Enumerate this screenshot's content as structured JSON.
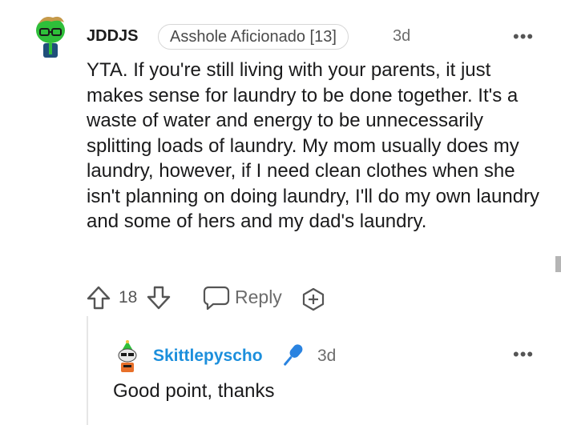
{
  "comment": {
    "username": "JDDJS",
    "flair": "Asshole Aficionado [13]",
    "time": "3d",
    "more": "•••",
    "body": "YTA. If you're still living with your parents, it just makes sense for laundry to be done together. It's a waste of water and energy to be unnecessarily splitting loads of laundry. My mom usually does my laundry, however, if I need clean clothes when she isn't planning on doing laundry, I'll do my own laundry and some of hers and my dad's laundry.",
    "votes": "18",
    "reply_label": "Reply",
    "icons": [
      "avatar",
      "upvote-icon",
      "downvote-icon",
      "reply-icon",
      "award-icon",
      "more-icon"
    ]
  },
  "reply": {
    "username": "Skittlepyscho",
    "time": "3d",
    "more": "•••",
    "body": "Good point, thanks",
    "icons": [
      "avatar",
      "microphone-icon",
      "more-icon"
    ]
  },
  "colors": {
    "username_reply": "#1c8fdc",
    "mic_icon": "#2a83e0",
    "avatar_green": "#2fbf3a",
    "text_muted": "#6c6c6c"
  }
}
